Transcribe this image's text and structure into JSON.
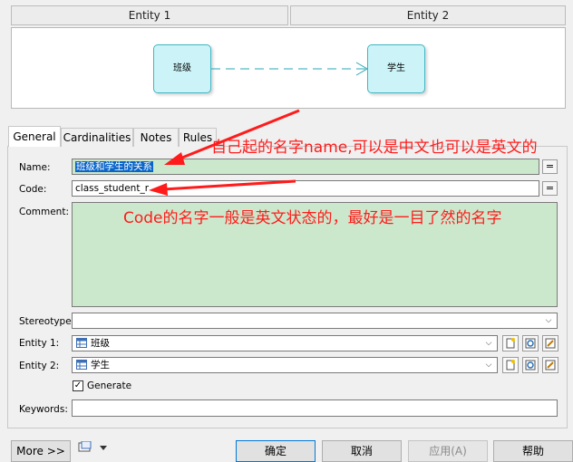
{
  "header": {
    "entity1_col": "Entity 1",
    "entity2_col": "Entity 2"
  },
  "diagram": {
    "left_entity": "班级",
    "right_entity": "学生"
  },
  "tabs": [
    {
      "label": "General",
      "active": true
    },
    {
      "label": "Cardinalities",
      "active": false
    },
    {
      "label": "Notes",
      "active": false
    },
    {
      "label": "Rules",
      "active": false
    }
  ],
  "form": {
    "name_label": "Name:",
    "name_value": "班级和学生的关系",
    "code_label": "Code:",
    "code_value": "class_student_r",
    "comment_label": "Comment:",
    "stereotype_label": "Stereotype:",
    "entity1_label": "Entity 1:",
    "entity1_value": "班级",
    "entity2_label": "Entity 2:",
    "entity2_value": "学生",
    "generate_label": "Generate",
    "generate_checked": true,
    "keywords_label": "Keywords:",
    "eq_glyph": "="
  },
  "annotations": {
    "name_note": "自己起的名字name,可以是中文也可以是英文的",
    "code_note": "Code的名字一般是英文状态的，最好是一目了然的名字"
  },
  "buttons": {
    "more": "More >>",
    "ok": "确定",
    "cancel": "取消",
    "apply": "应用(A)",
    "help": "帮助"
  },
  "colors": {
    "annotation": "#ff1b1b",
    "entity_fill": "#ccf4f8",
    "entity_border": "#40b6c2",
    "comment_fill": "#cce8cc",
    "selection": "#0a64c8"
  }
}
